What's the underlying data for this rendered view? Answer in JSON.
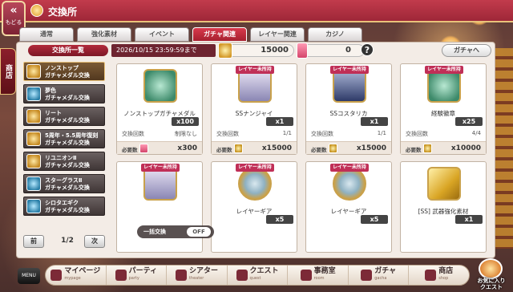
{
  "header": {
    "back_arrow": "«",
    "back_label": "もどる",
    "title": "交換所"
  },
  "tabs": [
    {
      "label": "通常",
      "active": false
    },
    {
      "label": "強化素材",
      "active": false
    },
    {
      "label": "イベント",
      "active": false
    },
    {
      "label": "ガチャ関連",
      "active": true
    },
    {
      "label": "レイヤー関連",
      "active": false
    },
    {
      "label": "カジノ",
      "active": false
    }
  ],
  "side_tag": "商店",
  "list_header": "交換所一覧",
  "deadline": "2026/10/15 23:59:59まで",
  "resources": {
    "primary": "15000",
    "secondary": "0",
    "help": "?"
  },
  "to_gacha": "ガチャへ",
  "exchange_list": [
    {
      "line1": "ノンストップ",
      "line2": "ガチャメダル交換",
      "icon": "medal-icon",
      "active": true
    },
    {
      "line1": "夢色",
      "line2": "ガチャメダル交換",
      "icon": "medal-icon",
      "active": false
    },
    {
      "line1": "リート",
      "line2": "ガチャメダル交換",
      "icon": "medal-icon",
      "active": false
    },
    {
      "line1": "5周年・5.5周年復刻",
      "line2": "ガチャメダル交換",
      "icon": "medal-icon",
      "active": false
    },
    {
      "line1": "リユニオンⅡ",
      "line2": "ガチャメダル交換",
      "icon": "medal-icon",
      "active": false
    },
    {
      "line1": "スターグラスⅡ",
      "line2": "ガチャメダル交換",
      "icon": "medal-icon",
      "active": false
    },
    {
      "line1": "シロタエギク",
      "line2": "ガチャメダル交換",
      "icon": "medal-icon",
      "active": false
    }
  ],
  "pager": {
    "prev": "前",
    "page": "1/2",
    "next": "次"
  },
  "cards": [
    {
      "badge": "",
      "name": "ノンストップガチャメダル",
      "qty": "x100",
      "limit_label": "交換回数",
      "limit": "制限なし",
      "cost_label": "必要数",
      "cost": "x300",
      "thumb": "medal",
      "cost_icon": "pink"
    },
    {
      "badge": "レイヤー未所持",
      "name": "SSナンジャイ",
      "qty": "x1",
      "limit_label": "交換回数",
      "limit": "1/1",
      "cost_label": "必要数",
      "cost": "x15000",
      "thumb": "portrait",
      "cost_icon": "gold"
    },
    {
      "badge": "レイヤー未所持",
      "name": "SSコスタリカ",
      "qty": "x1",
      "limit_label": "交換回数",
      "limit": "1/1",
      "cost_label": "必要数",
      "cost": "x15000",
      "thumb": "portrait dark",
      "cost_icon": "gold"
    },
    {
      "badge": "レイヤー未所持",
      "name": "経験徽章",
      "qty": "x25",
      "limit_label": "交換回数",
      "limit": "4/4",
      "cost_label": "必要数",
      "cost": "x10000",
      "thumb": "medal",
      "cost_icon": "gold"
    },
    {
      "badge": "レイヤー未所持",
      "name": "",
      "qty": "",
      "limit_label": "",
      "limit": "",
      "cost_label": "",
      "cost": "",
      "thumb": "portrait",
      "cost_icon": "gold"
    },
    {
      "badge": "レイヤー未所持",
      "name": "レイヤーギア",
      "qty": "x5",
      "limit_label": "",
      "limit": "",
      "cost_label": "",
      "cost": "",
      "thumb": "gear",
      "cost_icon": "gold"
    },
    {
      "badge": "レイヤー未所持",
      "name": "レイヤーギア",
      "qty": "x5",
      "limit_label": "",
      "limit": "",
      "cost_label": "",
      "cost": "",
      "thumb": "gear",
      "cost_icon": "gold"
    },
    {
      "badge": "",
      "name": "[SS] 武器強化素材",
      "qty": "x1",
      "limit_label": "",
      "limit": "",
      "cost_label": "",
      "cost": "",
      "thumb": "gold",
      "cost_icon": "gold"
    }
  ],
  "bulk": {
    "label": "一括交換",
    "toggle": "OFF"
  },
  "nav": [
    {
      "label": "マイページ",
      "sub": "mypage",
      "icon": "home-icon"
    },
    {
      "label": "パーティ",
      "sub": "party",
      "icon": "party-icon"
    },
    {
      "label": "シアター",
      "sub": "theater",
      "icon": "camera-icon"
    },
    {
      "label": "クエスト",
      "sub": "quest",
      "icon": "swords-icon"
    },
    {
      "label": "事務室",
      "sub": "room",
      "icon": "desk-icon"
    },
    {
      "label": "ガチャ",
      "sub": "gacha",
      "icon": "ticket-icon"
    },
    {
      "label": "商店",
      "sub": "shop",
      "icon": "shop-icon"
    }
  ],
  "nav_menu": "MENU",
  "favorite": {
    "line1": "お気に入り",
    "line2": "クエスト"
  }
}
